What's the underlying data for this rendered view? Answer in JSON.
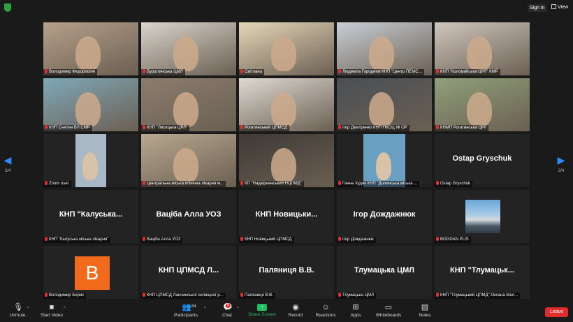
{
  "topbar": {
    "signin": "Sign in",
    "view": "View"
  },
  "nav": {
    "left_page": "2/4",
    "right_page": "2/4"
  },
  "tiles": [
    {
      "name": "Володимир Федоришин",
      "type": "video",
      "bg": "#b5a08a"
    },
    {
      "name": "Бурштинська ЦМЛ",
      "type": "video",
      "bg": "#d9d4cc"
    },
    {
      "name": "Світлана",
      "type": "video",
      "bg": "#e4d7b8"
    },
    {
      "name": "Людмила Городнюк КНП \"Центр ПЕМС...",
      "type": "video",
      "bg": "#c9cfd6"
    },
    {
      "name": "КНП \"Коломийська ЦРЛ\" КМР",
      "type": "video",
      "bg": "#cfc6bd"
    },
    {
      "name": "КНП Снятин ВЛ СМР",
      "type": "video",
      "bg": "#7fa8b8"
    },
    {
      "name": "КНП \"Лисецька ЦРЛ\"",
      "type": "video",
      "bg": "#8a7d6e"
    },
    {
      "name": "Рогатинський ЦПМСД",
      "type": "video",
      "bg": "#ddd9d2"
    },
    {
      "name": "Ігор Дмитренко КНП ПКОЦ ІФ ОР",
      "type": "video",
      "bg": "#4a4f55"
    },
    {
      "name": "КНМП Рогатинська ЦРЛ",
      "type": "video",
      "bg": "#8fa07a"
    },
    {
      "name": "Zoom user",
      "type": "video-small",
      "bg": "#a8b8c4"
    },
    {
      "name": "Центральна міська клінічна лікарня м...",
      "type": "video",
      "bg": "#b8a890"
    },
    {
      "name": "КП \"Надвірнянський НЦПМД\"",
      "type": "video",
      "bg": "#3e3a36"
    },
    {
      "name": "Ганна Худяк КНП \"Долинська міська ...",
      "type": "video-small",
      "bg": "#6b9fc2"
    },
    {
      "name": "Ostap Gryschuk",
      "type": "text",
      "big": "Ostap Gryschuk"
    },
    {
      "name": "КНП \"Калуська міська лікарня\"",
      "type": "text",
      "big": "КНП \"Калуська..."
    },
    {
      "name": "Ваціба Алла УОЗ",
      "type": "text",
      "big": "Ваціба Алла УОЗ"
    },
    {
      "name": "КНП Новицький ЦПМСД",
      "type": "text",
      "big": "КНП Новицьки..."
    },
    {
      "name": "Ігор Дождажнюк",
      "type": "text",
      "big": "Ігор Дождажнюк"
    },
    {
      "name": "BOGDAN PLIS",
      "type": "image"
    },
    {
      "name": "Володимир Борис",
      "type": "avatar",
      "letter": "B"
    },
    {
      "name": "КНП ЦПМСД Ланчинської селищної р...",
      "type": "text",
      "big": "КНП ЦПМСД Л..."
    },
    {
      "name": "Паляниця В.В.",
      "type": "text",
      "big": "Паляниця В.В."
    },
    {
      "name": "Тлумацька ЦМЛ",
      "type": "text",
      "big": "Тлумацька ЦМЛ"
    },
    {
      "name": "КНП \"Тлумацький ЦПМД\" Оксана Мел...",
      "type": "text",
      "big": "КНП \"Тлумацьк..."
    }
  ],
  "toolbar": {
    "unmute": "Unmute",
    "start_video": "Start Video",
    "participants": "Participants",
    "participants_count": "84",
    "chat": "Chat",
    "chat_badge": "8",
    "share_screen": "Share Screen",
    "record": "Record",
    "reactions": "Reactions",
    "apps": "Apps",
    "whiteboards": "Whiteboards",
    "notes": "Notes",
    "leave": "Leave"
  },
  "colors": {
    "accent": "#2d8cff",
    "share": "#1fbf5b",
    "leave": "#e02d2d",
    "avatar": "#f26b1d"
  }
}
